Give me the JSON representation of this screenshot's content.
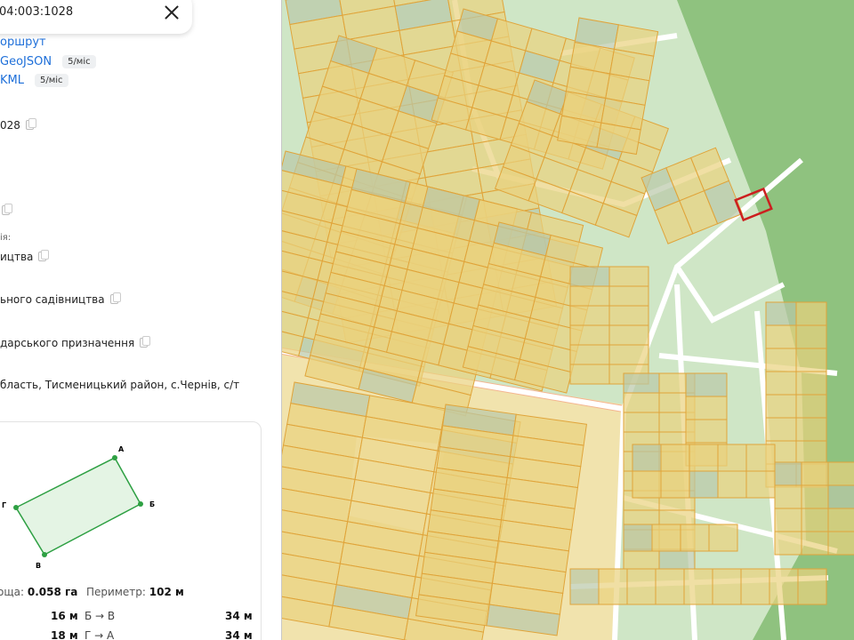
{
  "search": {
    "query": "04:003:1028"
  },
  "links": [
    {
      "label": "оршрут",
      "badge": ""
    },
    {
      "label": "GeoJSON",
      "badge": "5/міс"
    },
    {
      "label": "KML",
      "badge": "5/міс"
    }
  ],
  "details": {
    "cadastral_tail": "028",
    "category_label": "ія:",
    "category": "ицтва",
    "purpose": "ьного садівництва",
    "ownership": "дарського призначення",
    "address": "бласть, Тисменицький район, с.Чернів, с/т"
  },
  "shape": {
    "vertices": {
      "a": "А",
      "b": "Б",
      "v": "В",
      "g": "Г"
    },
    "area_label": "ощa:",
    "area_value": "0.058 га",
    "perimeter_label": "Периметр:",
    "perimeter_value": "102 м",
    "segments": [
      {
        "left_value": "16 м",
        "name": "Б → В",
        "right_value": "34 м"
      },
      {
        "left_value": "18 м",
        "name": "Г → А",
        "right_value": "34 м"
      }
    ]
  },
  "colors": {
    "map_bg": "#cfe6c6",
    "forest": "#8fc27f",
    "parcel_fill": "#e9d27e",
    "parcel_stroke": "#e0a43a",
    "road": "#ffffff",
    "selected": "#cc1f1f",
    "link": "#1e6fd9"
  }
}
